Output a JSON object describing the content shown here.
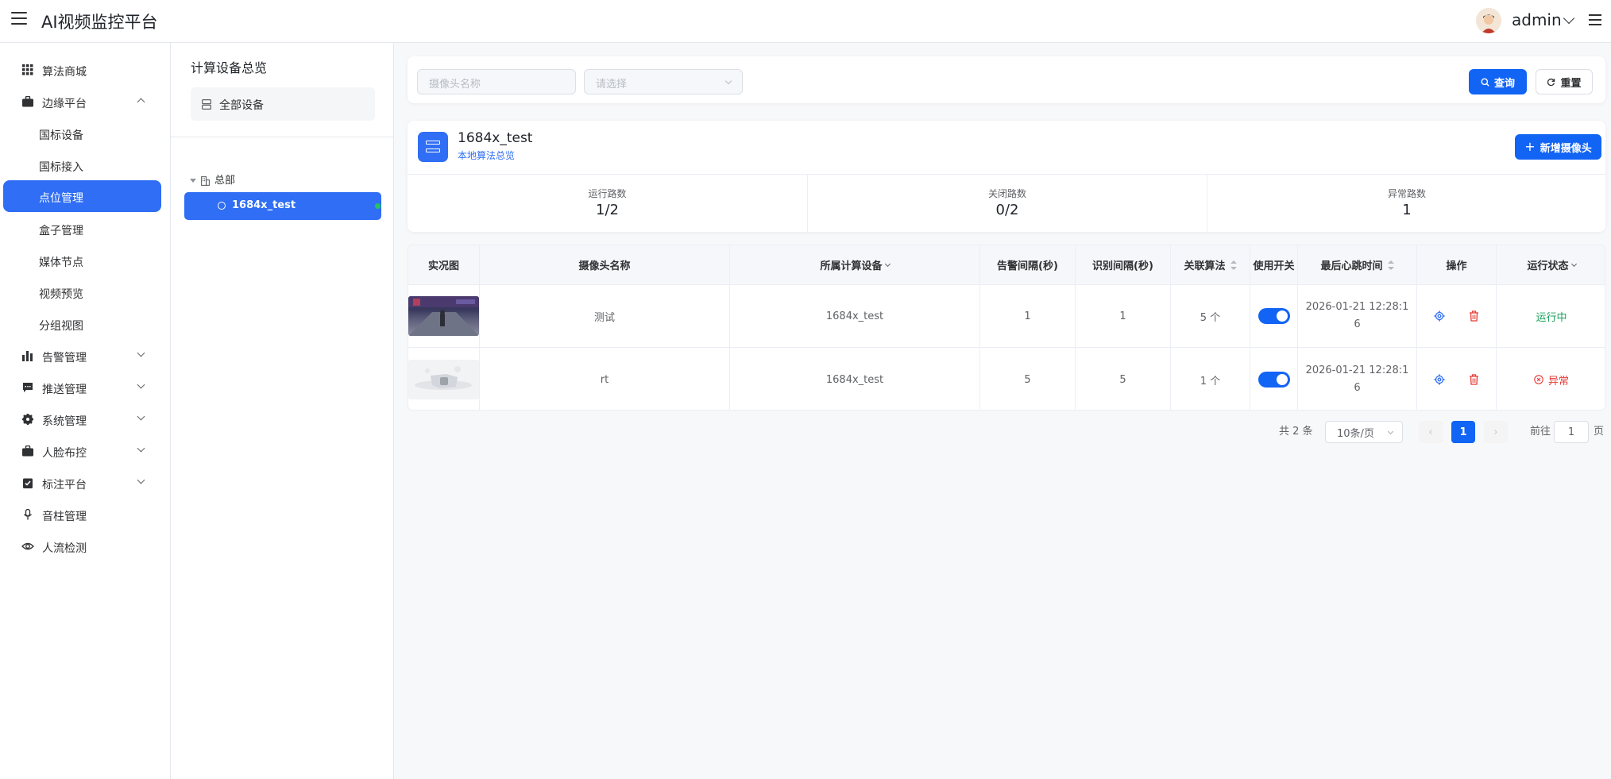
{
  "app": {
    "title": "AI视频监控平台",
    "user": "admin"
  },
  "sidebar": {
    "items": [
      {
        "label": "算法商城",
        "icon": "grid-icon"
      },
      {
        "label": "边缘平台",
        "icon": "briefcase-icon",
        "expanded": true
      },
      {
        "label": "国标设备"
      },
      {
        "label": "国标接入"
      },
      {
        "label": "点位管理",
        "active": true
      },
      {
        "label": "盒子管理"
      },
      {
        "label": "媒体节点"
      },
      {
        "label": "视频预览"
      },
      {
        "label": "分组视图"
      },
      {
        "label": "告警管理",
        "icon": "bar-chart-icon"
      },
      {
        "label": "推送管理",
        "icon": "message-icon"
      },
      {
        "label": "系统管理",
        "icon": "gear-icon"
      },
      {
        "label": "人脸布控",
        "icon": "briefcase-icon"
      },
      {
        "label": "标注平台",
        "icon": "clipboard-icon"
      },
      {
        "label": "音柱管理",
        "icon": "microphone-icon"
      },
      {
        "label": "人流检测",
        "icon": "eye-icon"
      }
    ]
  },
  "tree": {
    "title": "计算设备总览",
    "all_label": "全部设备",
    "root_label": "总部",
    "node_label": "1684x_test"
  },
  "search": {
    "camera_placeholder": "摄像头名称",
    "select_placeholder": "请选择",
    "query_label": "查询",
    "reset_label": "重置"
  },
  "device": {
    "name": "1684x_test",
    "link": "本地算法总览",
    "add_label": "新增摄像头",
    "stats": [
      {
        "label": "运行路数",
        "value": "1/2"
      },
      {
        "label": "关闭路数",
        "value": "0/2"
      },
      {
        "label": "异常路数",
        "value": "1"
      }
    ]
  },
  "table": {
    "headers": {
      "snapshot": "实况图",
      "camera_name": "摄像头名称",
      "device": "所属计算设备",
      "alarm_interval": "告警间隔(秒)",
      "recog_interval": "识别间隔(秒)",
      "algorithms": "关联算法",
      "switch": "使用开关",
      "heartbeat": "最后心跳时间",
      "actions": "操作",
      "status": "运行状态"
    },
    "rows": [
      {
        "camera_name": "测试",
        "device": "1684x_test",
        "alarm_interval": "1",
        "recog_interval": "1",
        "algorithms": "5 个",
        "switch_on": true,
        "heartbeat_a": "2026-01-21 12:28:1",
        "heartbeat_b": "6",
        "status": "运行中",
        "status_kind": "ok"
      },
      {
        "camera_name": "rt",
        "device": "1684x_test",
        "alarm_interval": "5",
        "recog_interval": "5",
        "algorithms": "1 个",
        "switch_on": true,
        "heartbeat_a": "2026-01-21 12:28:1",
        "heartbeat_b": "6",
        "status": "异常",
        "status_kind": "error"
      }
    ]
  },
  "pagination": {
    "total": "共 2 条",
    "page_size": "10条/页",
    "current": "1",
    "goto_prefix": "前往",
    "goto_value": "1",
    "goto_suffix": "页"
  },
  "colors": {
    "primary": "#1264f5",
    "ok": "#19a35b",
    "error": "#e53935"
  }
}
